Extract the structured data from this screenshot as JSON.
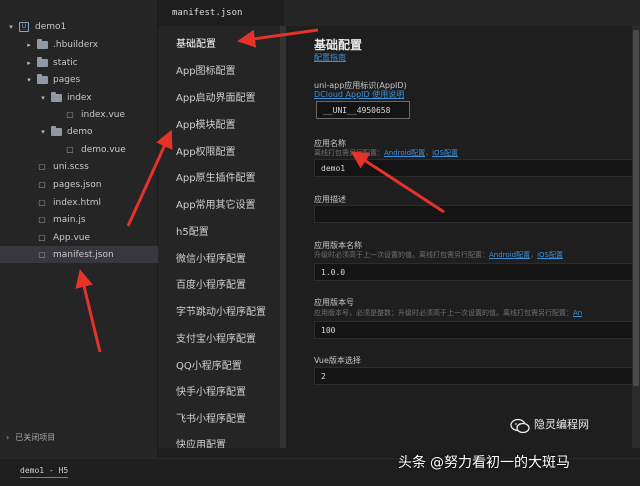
{
  "explorer": {
    "items": [
      {
        "label": "demo1",
        "depth": 0,
        "kind": "project",
        "expanded": true
      },
      {
        "label": ".hbuilderx",
        "depth": 1,
        "kind": "folder",
        "expanded": false
      },
      {
        "label": "static",
        "depth": 1,
        "kind": "folder",
        "expanded": false
      },
      {
        "label": "pages",
        "depth": 1,
        "kind": "folder",
        "expanded": true
      },
      {
        "label": "index",
        "depth": 2,
        "kind": "folder",
        "expanded": true
      },
      {
        "label": "index.vue",
        "depth": 3,
        "kind": "file"
      },
      {
        "label": "demo",
        "depth": 2,
        "kind": "folder",
        "expanded": true
      },
      {
        "label": "demo.vue",
        "depth": 3,
        "kind": "file"
      },
      {
        "label": "uni.scss",
        "depth": 1,
        "kind": "file"
      },
      {
        "label": "pages.json",
        "depth": 1,
        "kind": "file"
      },
      {
        "label": "index.html",
        "depth": 1,
        "kind": "file"
      },
      {
        "label": "main.js",
        "depth": 1,
        "kind": "file"
      },
      {
        "label": "App.vue",
        "depth": 1,
        "kind": "file"
      },
      {
        "label": "manifest.json",
        "depth": 1,
        "kind": "file",
        "selected": true
      }
    ],
    "closed_projects": "已关闭项目"
  },
  "editor": {
    "tab_title": "manifest.json"
  },
  "nav": {
    "items": [
      {
        "label": "基础配置",
        "active": true
      },
      {
        "label": "App图标配置"
      },
      {
        "label": "App启动界面配置"
      },
      {
        "label": "App模块配置"
      },
      {
        "label": "App权限配置"
      },
      {
        "label": "App原生插件配置"
      },
      {
        "label": "App常用其它设置"
      },
      {
        "label": "h5配置"
      },
      {
        "label": "微信小程序配置"
      },
      {
        "label": "百度小程序配置"
      },
      {
        "label": "字节跳动小程序配置"
      },
      {
        "label": "支付宝小程序配置"
      },
      {
        "label": "QQ小程序配置"
      },
      {
        "label": "快手小程序配置"
      },
      {
        "label": "飞书小程序配置"
      },
      {
        "label": "快应用配置"
      }
    ]
  },
  "settings": {
    "title": "基础配置",
    "guide_link": "配置指南",
    "appid": {
      "label": "uni-app应用标识(AppID)",
      "link": "DCloud AppID 使用说明",
      "value": "__UNI__4950658"
    },
    "app_name": {
      "label": "应用名称",
      "hint": "离线打包需另行配置：",
      "hint_link1": "Android配置",
      "hint_sep": "，",
      "hint_link2": "iOS配置",
      "value": "demo1"
    },
    "app_desc": {
      "label": "应用描述",
      "value": ""
    },
    "version_name": {
      "label": "应用版本名称",
      "hint": "升级时必须高于上一次设置的值。离线打包需另行配置：",
      "hint_link1": "Android配置",
      "hint_sep": "，",
      "hint_link2": "iOS配置",
      "value": "1.0.0"
    },
    "version_code": {
      "label": "应用版本号",
      "hint": "应用版本号，必须是整数；升级时必须高于上一次设置的值。离线打包需另行配置：",
      "hint_link": "An",
      "value": "100"
    },
    "vue_version": {
      "label": "Vue版本选择",
      "value": "2"
    }
  },
  "status": {
    "project": "demo1 - H5"
  },
  "watermark": {
    "source": "头条",
    "at_author": "@努力看初一的大斑马",
    "wechat_name": "隐灵编程网"
  },
  "colors": {
    "link": "#3d8fd6",
    "annotation_arrow": "#e5332a"
  }
}
